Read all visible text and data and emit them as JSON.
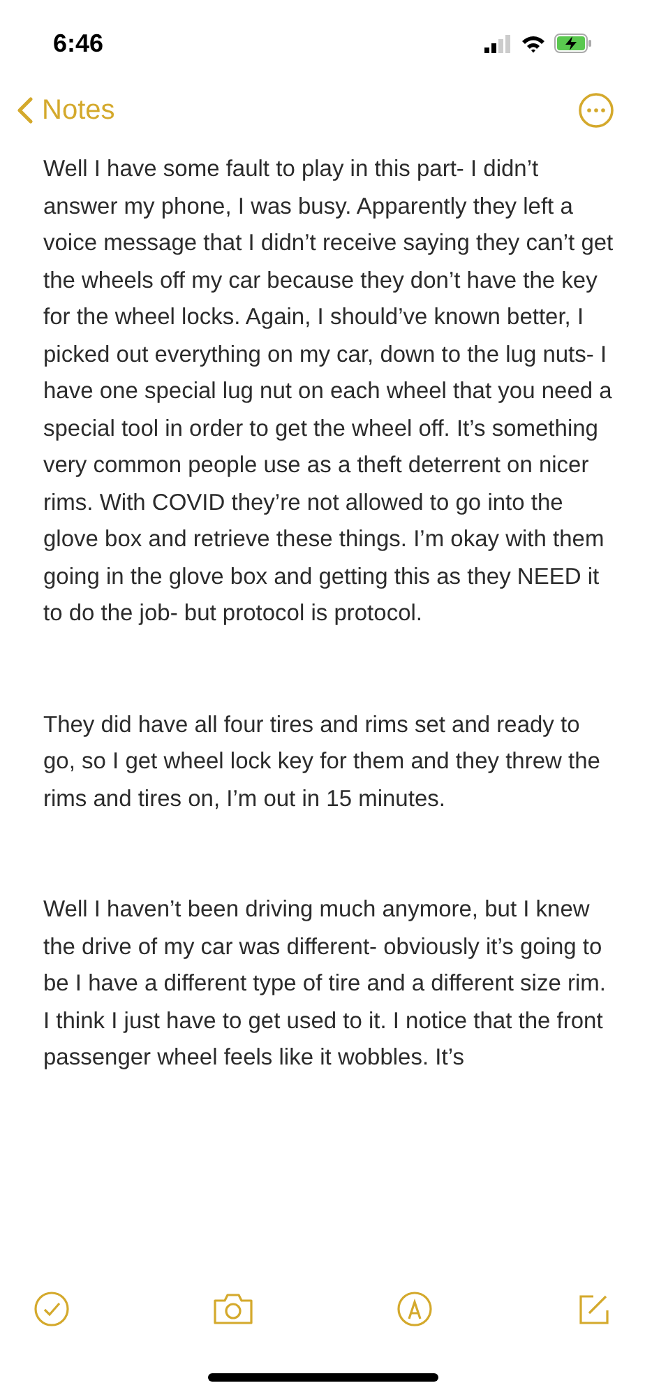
{
  "status_bar": {
    "time": "6:46"
  },
  "nav": {
    "back_label": "Notes"
  },
  "note": {
    "paragraphs": [
      "Well I have some fault to play in this part- I didn’t answer my phone, I was busy. Apparently they left a voice message that I didn’t receive saying they can’t get the wheels off my car because they don’t have the key for the wheel locks. Again, I should’ve known better, I picked out everything on my car, down to the lug nuts- I have one special lug nut on each wheel that you need a special tool in order to get the wheel off. It’s something very common people use as a theft deterrent on nicer rims. With COVID they’re not allowed to go into the glove box and retrieve these things. I’m okay with them going in the glove box and getting this as they NEED it to do the job- but protocol is protocol.",
      "They did have all four tires and rims set and ready to go, so I get wheel lock key for them and they threw the rims and tires on, I’m out in 15 minutes.",
      "Well I haven’t been driving much anymore, but I knew the drive of my car was different- obviously it’s going to be I have a different type of tire and a different size rim. I think I just have to get used to it. I notice that the front passenger wheel feels like it wobbles. It’s"
    ]
  }
}
